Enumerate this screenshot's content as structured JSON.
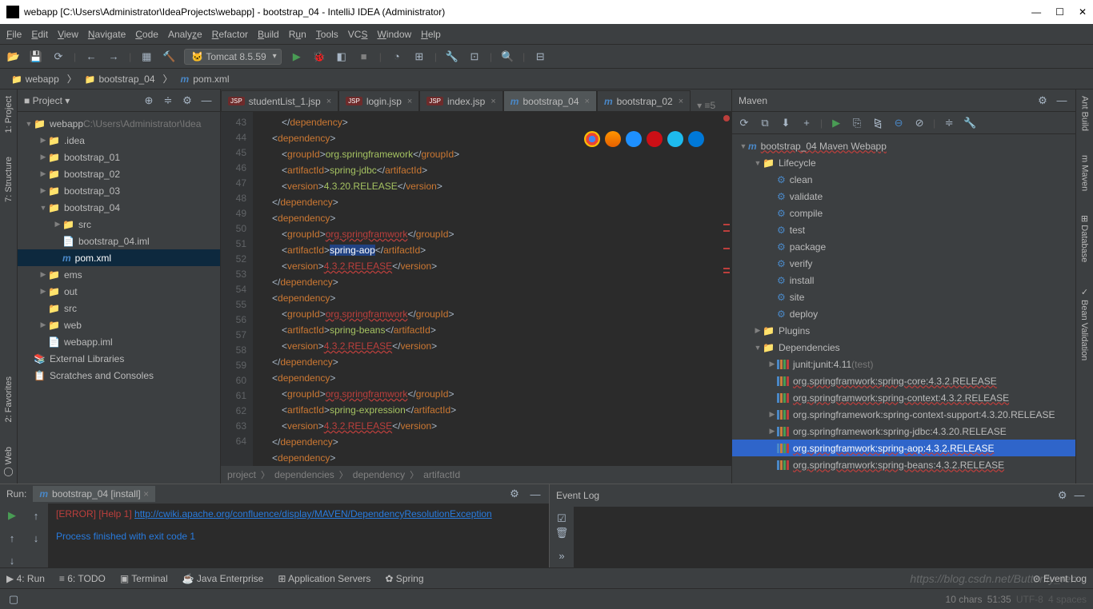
{
  "title": "webapp [C:\\Users\\Administrator\\IdeaProjects\\webapp] - bootstrap_04 - IntelliJ IDEA (Administrator)",
  "menu": [
    "File",
    "Edit",
    "View",
    "Navigate",
    "Code",
    "Analyze",
    "Refactor",
    "Build",
    "Run",
    "Tools",
    "VCS",
    "Window",
    "Help"
  ],
  "runConfig": "Tomcat 8.5.59",
  "crumbs": [
    "webapp",
    "bootstrap_04",
    "pom.xml"
  ],
  "projectPanel": {
    "title": "Project"
  },
  "tree": [
    {
      "d": 0,
      "a": "▼",
      "i": "folder blue",
      "t": "webapp",
      "sub": " C:\\Users\\Administrator\\Idea"
    },
    {
      "d": 1,
      "a": "▶",
      "i": "folder",
      "t": ".idea"
    },
    {
      "d": 1,
      "a": "▶",
      "i": "folder blue",
      "t": "bootstrap_01"
    },
    {
      "d": 1,
      "a": "▶",
      "i": "folder blue",
      "t": "bootstrap_02"
    },
    {
      "d": 1,
      "a": "▶",
      "i": "folder blue",
      "t": "bootstrap_03"
    },
    {
      "d": 1,
      "a": "▼",
      "i": "folder blue",
      "t": "bootstrap_04"
    },
    {
      "d": 2,
      "a": "▶",
      "i": "folder",
      "t": "src"
    },
    {
      "d": 2,
      "a": "",
      "i": "file",
      "t": "bootstrap_04.iml"
    },
    {
      "d": 2,
      "a": "",
      "i": "m",
      "t": "pom.xml",
      "sel": true
    },
    {
      "d": 1,
      "a": "▶",
      "i": "folder orange",
      "t": "ems"
    },
    {
      "d": 1,
      "a": "▶",
      "i": "folder orange",
      "t": "out"
    },
    {
      "d": 1,
      "a": "",
      "i": "folder",
      "t": "src"
    },
    {
      "d": 1,
      "a": "▶",
      "i": "folder blue",
      "t": "web"
    },
    {
      "d": 1,
      "a": "",
      "i": "file",
      "t": "webapp.iml"
    },
    {
      "d": 0,
      "a": "",
      "i": "lib",
      "t": "External Libraries"
    },
    {
      "d": 0,
      "a": "",
      "i": "scratch",
      "t": "Scratches and Consoles"
    }
  ],
  "tabs": [
    {
      "icon": "jsp",
      "label": "studentList_1.jsp"
    },
    {
      "icon": "jsp",
      "label": "login.jsp"
    },
    {
      "icon": "jsp",
      "label": "index.jsp"
    },
    {
      "icon": "m",
      "label": "bootstrap_04",
      "active": true
    },
    {
      "icon": "m",
      "label": "bootstrap_02"
    }
  ],
  "lines": [
    43,
    44,
    45,
    46,
    47,
    48,
    49,
    50,
    51,
    52,
    53,
    54,
    55,
    56,
    57,
    58,
    59,
    60,
    61,
    62,
    63,
    64
  ],
  "editorCrumbs": [
    "project",
    "dependencies",
    "dependency",
    "artifactId"
  ],
  "mavenPanel": "Maven",
  "mavenTree": [
    {
      "d": 0,
      "a": "▼",
      "i": "m",
      "t": "bootstrap_04 Maven Webapp",
      "wavy": true
    },
    {
      "d": 1,
      "a": "▼",
      "i": "folder",
      "t": "Lifecycle"
    },
    {
      "d": 2,
      "i": "gear",
      "t": "clean"
    },
    {
      "d": 2,
      "i": "gear",
      "t": "validate"
    },
    {
      "d": 2,
      "i": "gear",
      "t": "compile"
    },
    {
      "d": 2,
      "i": "gear",
      "t": "test"
    },
    {
      "d": 2,
      "i": "gear",
      "t": "package"
    },
    {
      "d": 2,
      "i": "gear",
      "t": "verify"
    },
    {
      "d": 2,
      "i": "gear",
      "t": "install"
    },
    {
      "d": 2,
      "i": "gear",
      "t": "site"
    },
    {
      "d": 2,
      "i": "gear",
      "t": "deploy"
    },
    {
      "d": 1,
      "a": "▶",
      "i": "folder",
      "t": "Plugins"
    },
    {
      "d": 1,
      "a": "▼",
      "i": "folder",
      "t": "Dependencies"
    },
    {
      "d": 2,
      "a": "▶",
      "i": "lib",
      "t": "junit:junit:4.11",
      "sub": " (test)"
    },
    {
      "d": 2,
      "i": "lib",
      "t": "org.springframwork:spring-core:4.3.2.RELEASE",
      "wavy": true
    },
    {
      "d": 2,
      "i": "lib",
      "t": "org.springframwork:spring-context:4.3.2.RELEASE",
      "wavy": true
    },
    {
      "d": 2,
      "a": "▶",
      "i": "lib",
      "t": "org.springframework:spring-context-support:4.3.20.RELEASE"
    },
    {
      "d": 2,
      "a": "▶",
      "i": "lib",
      "t": "org.springframework:spring-jdbc:4.3.20.RELEASE"
    },
    {
      "d": 2,
      "i": "lib",
      "t": "org.springframwork:spring-aop:4.3.2.RELEASE",
      "wavy": true,
      "sel": true
    },
    {
      "d": 2,
      "i": "lib",
      "t": "org.springframwork:spring-beans:4.3.2.RELEASE",
      "wavy": true
    }
  ],
  "run": {
    "title": "Run:",
    "tab": "bootstrap_04 [install]",
    "err": "[ERROR] [Help 1] ",
    "link": "http://cwiki.apache.org/confluence/display/MAVEN/DependencyResolutionException",
    "exit": "Process finished with exit code 1"
  },
  "eventLog": "Event Log",
  "statusTabs": [
    "▶ 4: Run",
    "≡ 6: TODO",
    "▣ Terminal",
    "☕ Java Enterprise",
    "⊞ Application Servers",
    "✿ Spring"
  ],
  "statusEvent": "⊙ Event Log",
  "info": {
    "chars": "10 chars",
    "pos": "51:35",
    "enc": "UTF-8",
    "spaces": "4 spaces"
  },
  "leftTabs": [
    "1: Project",
    "7: Structure",
    "2: Favorites",
    "◯ Web"
  ],
  "rightTabs": [
    "Ant Build",
    "m Maven",
    "⊞ Database",
    "✓ Bean Validation"
  ],
  "watermark": "https://blog.csdn.net/Butterfly_ren"
}
